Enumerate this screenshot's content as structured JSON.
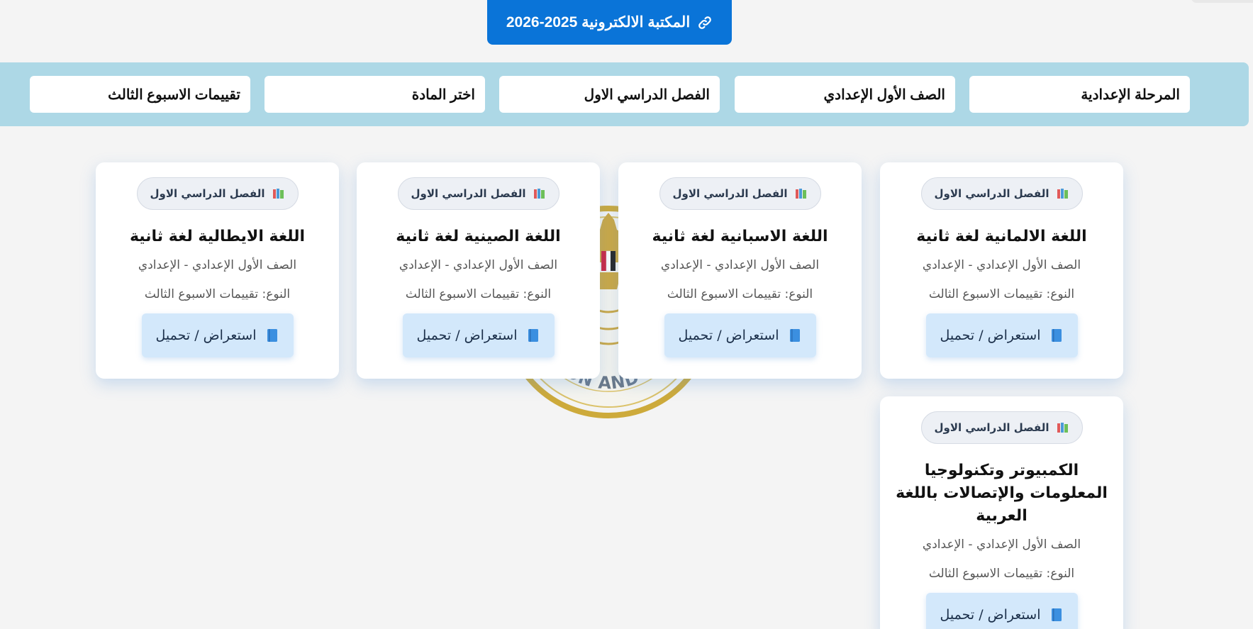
{
  "header": {
    "library_button_label": "المكتبة الالكترونية 2025-2026",
    "library_icon": "link-icon"
  },
  "filters": [
    {
      "label": "المرحلة الإعدادية"
    },
    {
      "label": "الصف الأول الإعدادي"
    },
    {
      "label": "الفصل الدراسي الاول"
    },
    {
      "label": "اختر المادة"
    },
    {
      "label": "تقييمات الاسبوع الثالث"
    }
  ],
  "emblem": {
    "text": "CATION AND TECH"
  },
  "cards": [
    {
      "badge": "الفصل الدراسي الاول",
      "title": "اللغة الالمانية لغة ثانية",
      "grade": "الصف الأول الإعدادي - الإعدادي",
      "type": "النوع: تقييمات الاسبوع الثالث",
      "button": "استعراض / تحميل"
    },
    {
      "badge": "الفصل الدراسي الاول",
      "title": "اللغة الاسبانية لغة ثانية",
      "grade": "الصف الأول الإعدادي - الإعدادي",
      "type": "النوع: تقييمات الاسبوع الثالث",
      "button": "استعراض / تحميل"
    },
    {
      "badge": "الفصل الدراسي الاول",
      "title": "اللغة الصينية لغة ثانية",
      "grade": "الصف الأول الإعدادي - الإعدادي",
      "type": "النوع: تقييمات الاسبوع الثالث",
      "button": "استعراض / تحميل"
    },
    {
      "badge": "الفصل الدراسي الاول",
      "title": "اللغة الايطالية لغة ثانية",
      "grade": "الصف الأول الإعدادي - الإعدادي",
      "type": "النوع: تقييمات الاسبوع الثالث",
      "button": "استعراض / تحميل"
    },
    {
      "badge": "الفصل الدراسي الاول",
      "title": "الكمبيوتر وتكنولوجيا المعلومات والإتصالات باللغة العربية",
      "grade": "الصف الأول الإعدادي - الإعدادي",
      "type": "النوع: تقييمات الاسبوع الثالث",
      "button": "استعراض / تحميل"
    }
  ],
  "colors": {
    "primary": "#0a74d8",
    "filter_bar": "#add8e6",
    "card_button": "#d3e8fb",
    "background": "#f4f4f4"
  }
}
